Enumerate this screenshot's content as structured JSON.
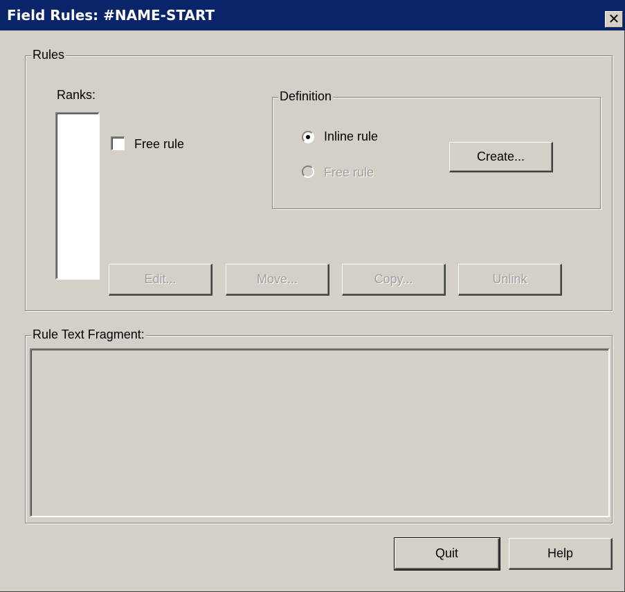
{
  "window": {
    "title": "Field Rules: #NAME-START",
    "close_glyph": "✕"
  },
  "rules": {
    "group_label": "Rules",
    "ranks_label": "Ranks:",
    "free_rule_checkbox_label": "Free rule",
    "free_rule_checked": false,
    "definition": {
      "group_label": "Definition",
      "inline_rule_label": "Inline rule",
      "inline_rule_selected": true,
      "free_rule_label": "Free rule",
      "free_rule_enabled": false,
      "create_button": "Create..."
    },
    "buttons": {
      "edit": "Edit...",
      "move": "Move...",
      "copy": "Copy...",
      "unlink": "Unlink"
    }
  },
  "fragment": {
    "group_label": "Rule Text Fragment:",
    "text": ""
  },
  "footer": {
    "quit": "Quit",
    "help": "Help"
  },
  "icons": {
    "close": "close-icon"
  },
  "colors": {
    "titlebar": "#0a246a",
    "face": "#d4d0c8",
    "disabled_text": "#a0a0a0"
  }
}
